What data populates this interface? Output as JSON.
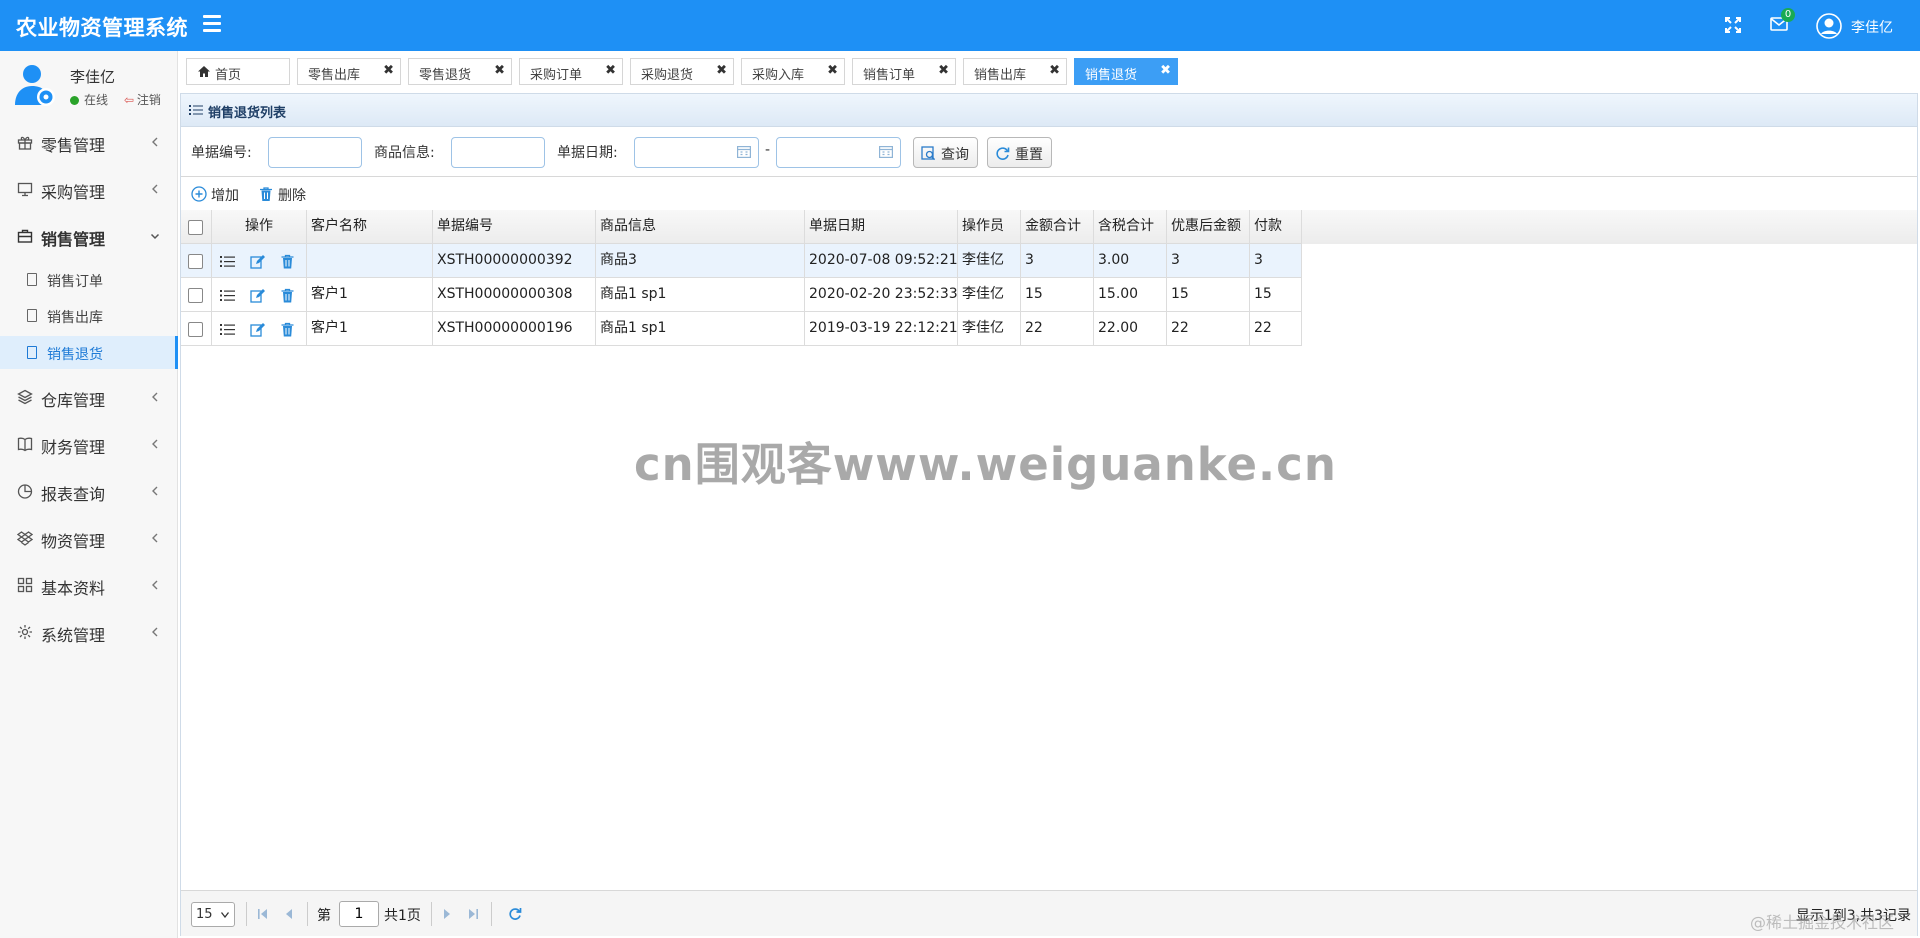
{
  "app": {
    "title": "农业物资管理系统",
    "notification_count": "0",
    "user_name": "李佳亿"
  },
  "sidebar": {
    "user_name": "李佳亿",
    "status_online": "在线",
    "logout_label": "注销",
    "menu": [
      {
        "label": "零售管理",
        "icon": "gift-icon"
      },
      {
        "label": "采购管理",
        "icon": "monitor-icon"
      },
      {
        "label": "销售管理",
        "icon": "briefcase-icon",
        "open": true,
        "children": [
          {
            "label": "销售订单"
          },
          {
            "label": "销售出库"
          },
          {
            "label": "销售退货",
            "active": true
          }
        ]
      },
      {
        "label": "仓库管理",
        "icon": "layers-icon"
      },
      {
        "label": "财务管理",
        "icon": "book-icon"
      },
      {
        "label": "报表查询",
        "icon": "pie-chart-icon"
      },
      {
        "label": "物资管理",
        "icon": "dropbox-icon"
      },
      {
        "label": "基本资料",
        "icon": "grid-icon"
      },
      {
        "label": "系统管理",
        "icon": "gear-icon"
      }
    ]
  },
  "tabs": [
    {
      "label": "首页"
    },
    {
      "label": "零售出库"
    },
    {
      "label": "零售退货"
    },
    {
      "label": "采购订单"
    },
    {
      "label": "采购退货"
    },
    {
      "label": "采购入库"
    },
    {
      "label": "销售订单"
    },
    {
      "label": "销售出库"
    },
    {
      "label": "销售退货",
      "active": true
    }
  ],
  "panel": {
    "title": "销售退货列表"
  },
  "search": {
    "number_label": "单据编号:",
    "number_value": "",
    "product_label": "商品信息:",
    "product_value": "",
    "date_label": "单据日期:",
    "date_from": "",
    "date_to": "",
    "dash": "-",
    "query_button": "查询",
    "reset_button": "重置"
  },
  "toolbar": {
    "add_label": "增加",
    "delete_label": "删除"
  },
  "table": {
    "headers": [
      "操作",
      "客户名称",
      "单据编号",
      "商品信息",
      "单据日期",
      "操作员",
      "金额合计",
      "含税合计",
      "优惠后金额",
      "付款"
    ],
    "rows": [
      {
        "customer": "",
        "number": "XSTH00000000392",
        "product": "商品3",
        "date": "2020-07-08 09:52:21",
        "operator": "李佳亿",
        "amount": "3",
        "tax_total": "3.00",
        "discounted": "3",
        "payment": "3"
      },
      {
        "customer": "客户1",
        "number": "XSTH00000000308",
        "product": "商品1 sp1",
        "date": "2020-02-20 23:52:33",
        "operator": "李佳亿",
        "amount": "15",
        "tax_total": "15.00",
        "discounted": "15",
        "payment": "15"
      },
      {
        "customer": "客户1",
        "number": "XSTH00000000196",
        "product": "商品1 sp1",
        "date": "2019-03-19 22:12:21",
        "operator": "李佳亿",
        "amount": "22",
        "tax_total": "22.00",
        "discounted": "22",
        "payment": "22"
      }
    ]
  },
  "pager": {
    "page_size": "15",
    "page_prefix": "第",
    "page_value": "1",
    "page_suffix": "共1页",
    "info": "显示1到3,共3记录"
  },
  "watermark": "cn围观客www.weiguanke.cn",
  "corner_watermark": "@稀土掘金技术社区",
  "colors": {
    "accent": "#1e90f5",
    "active_tab": "#3c9ef5",
    "online": "#2aa32a",
    "badge": "#1aaa55"
  }
}
